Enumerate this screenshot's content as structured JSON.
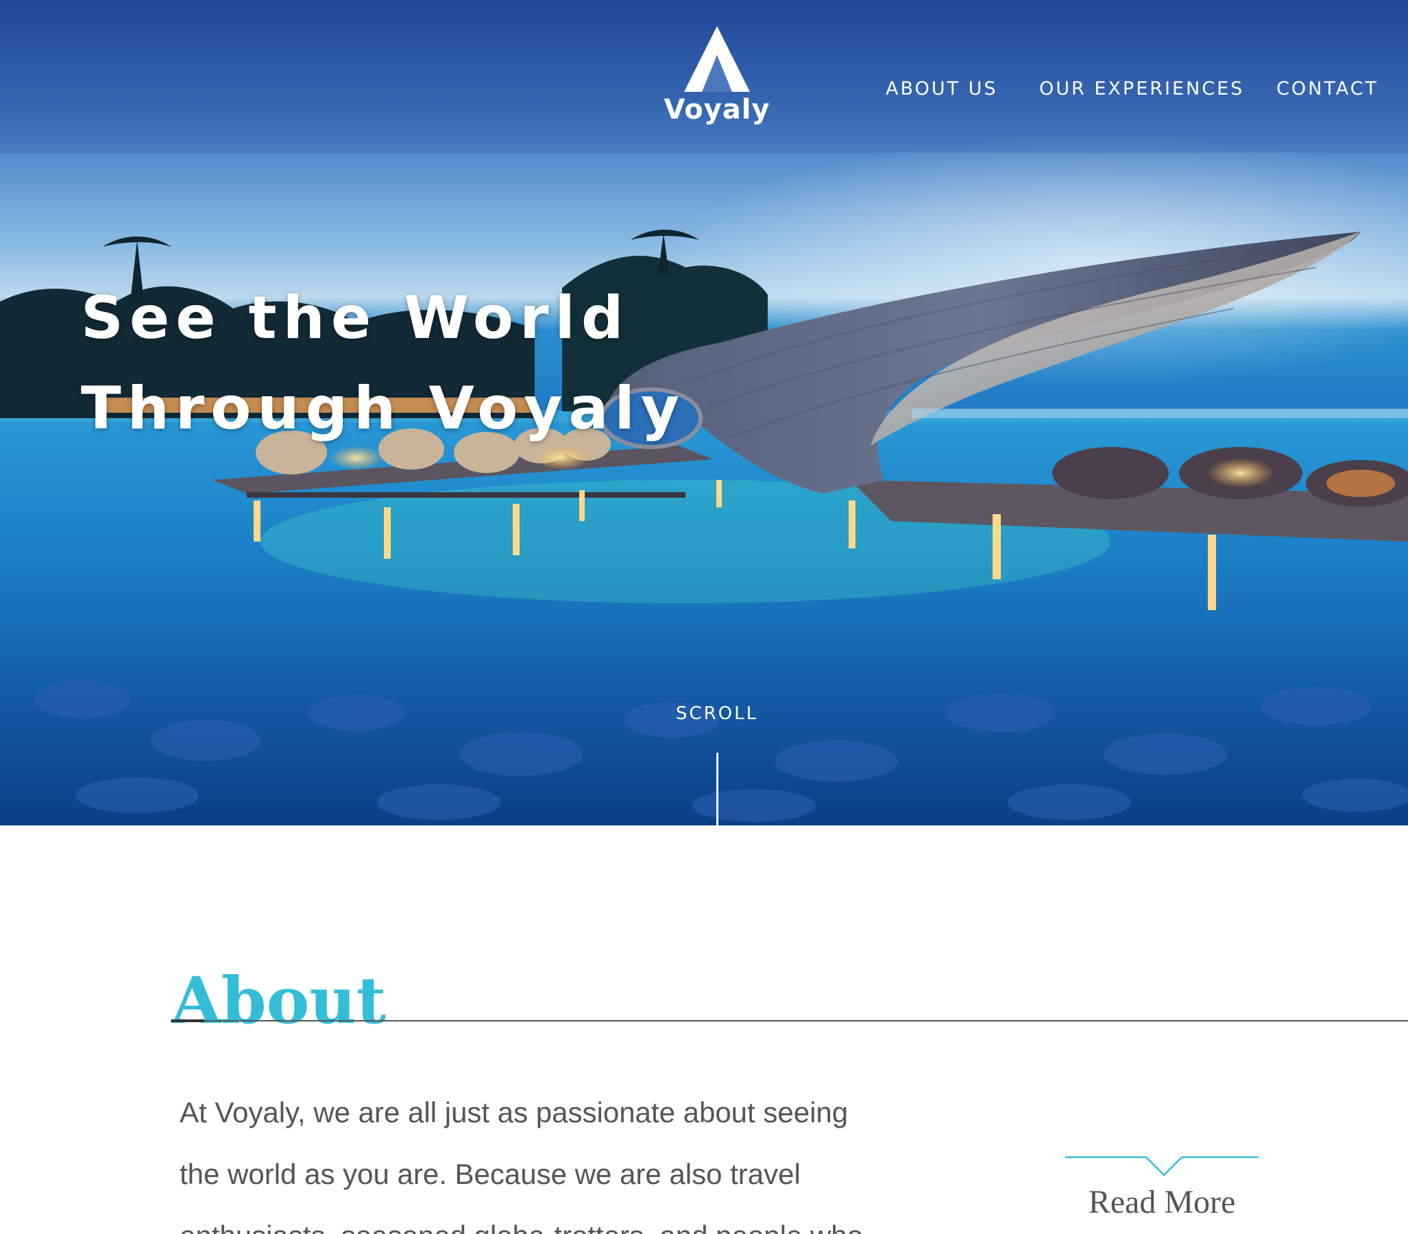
{
  "brand": {
    "name": "Voyaly"
  },
  "nav": {
    "items": [
      {
        "label": "ABOUT US"
      },
      {
        "label": "OUR EXPERIENCES"
      },
      {
        "label": "CONTACT"
      }
    ]
  },
  "hero": {
    "headline_line1": "See the World",
    "headline_line2": "Through Voyaly",
    "scroll_label": "SCROLL"
  },
  "about": {
    "title": "About",
    "body_lines": [
      "At Voyaly, we are all just as passionate about seeing",
      "the world as you are. Because we are also travel",
      "enthusiasts, seasoned globe-trotters, and people who"
    ],
    "read_more_label": "Read More"
  },
  "colors": {
    "accent": "#33bdd9",
    "body_text": "#555555",
    "nav_text": "#ffffff",
    "rule": "#555555"
  },
  "icons": {
    "logo": "voyaly-logo-icon",
    "read_more": "chevron-down-icon"
  }
}
